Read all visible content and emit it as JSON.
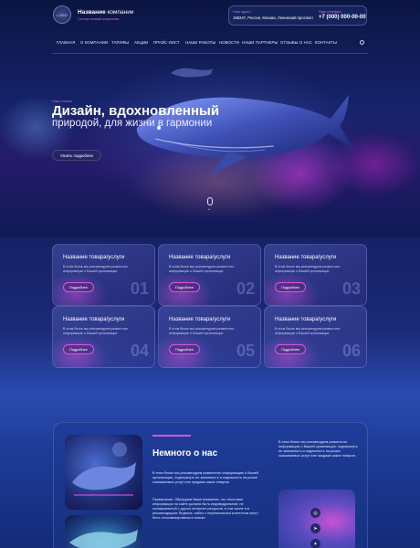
{
  "header": {
    "logo_text": "LOGO",
    "company_bold": "Название",
    "company_rest": " компании",
    "slogan": "Слоган вашей компании",
    "address_label": "Наш адрес:",
    "address": "196247, Россия, Москва, Ленинский проспект",
    "phone_label": "Наш телефон:",
    "phone": "+7 (000) 000-00-00"
  },
  "nav": {
    "items": [
      "ГЛАВНАЯ",
      "О КОМПАНИИ",
      "ТАРИФЫ",
      "АКЦИИ",
      "ПРАЙС-ЛИСТ",
      "НАШИ РАБОТЫ",
      "НОВОСТИ",
      "НАШИ ПАРТНЕРЫ",
      "ОТЗЫВЫ О НАС",
      "КОНТАКТЫ"
    ]
  },
  "hero": {
    "kicker": "Наш слоган",
    "title": "Дизайн, вдохновленный",
    "subtitle": "природой, для жизни в гармонии",
    "button": "Узнать подробнее"
  },
  "cards": [
    {
      "title": "Название товара/услуги",
      "text": "В этом блоке мы рекомендуем разместить информацию о Вашей организации",
      "button": "Подробнее",
      "num": "01"
    },
    {
      "title": "Название товара/услуги",
      "text": "В этом блоке мы рекомендуем разместить информацию о Вашей организации",
      "button": "Подробнее",
      "num": "02"
    },
    {
      "title": "Название товара/услуги",
      "text": "В этом блоке мы рекомендуем разместить информацию о Вашей организации",
      "button": "Подробнее",
      "num": "03"
    },
    {
      "title": "Название товара/услуги",
      "text": "В этом блоке мы рекомендуем разместить информацию о Вашей организации",
      "button": "Подробнее",
      "num": "04"
    },
    {
      "title": "Название товара/услуги",
      "text": "В этом блоке мы рекомендуем разместить информацию о Вашей организации",
      "button": "Подробнее",
      "num": "05"
    },
    {
      "title": "Название товара/услуги",
      "text": "В этом блоке мы рекомендуем разместить информацию о Вашей организации",
      "button": "Подробнее",
      "num": "06"
    }
  ],
  "about": {
    "title": "Немного о нас",
    "p1": "В этом блоке мы рекомендуем разместить информацию о Вашей организации, подчеркнуть ее значимость и надежность на рынке оказываемых услуг или продаже каких товаров.",
    "p2": "Примечание: Обращаем Ваше внимание, что текстовая информация на сайте должна быть индивидуальной, не скопированной с других интернет-ресурсов, в том числе и в рекомендациях Яндекса: сайты с неуникальным контентом могут быть пессимизированы в поиске.",
    "side": "В этом блоке мы рекомендуем разместить информацию о Вашей организации, подчеркнуть ее значимость и надежность на рынке оказываемых услуг или продаже каких товаров."
  },
  "social": [
    "instagram-icon",
    "telegram-icon",
    "vk-icon"
  ],
  "colors": {
    "accent": "#d454d8",
    "bg": "#142063"
  }
}
